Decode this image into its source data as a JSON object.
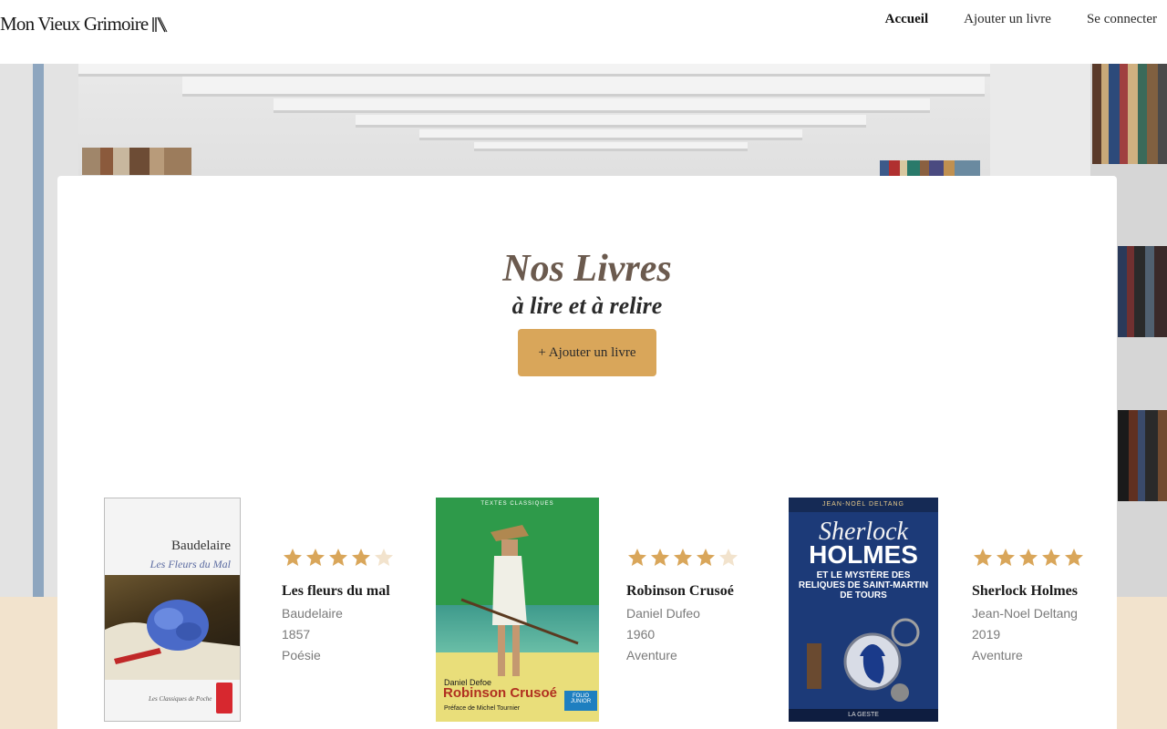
{
  "header": {
    "logo_text": "Mon Vieux Grimoire",
    "nav": [
      {
        "label": "Accueil",
        "active": true
      },
      {
        "label": "Ajouter un livre",
        "active": false
      },
      {
        "label": "Se connecter",
        "active": false
      }
    ]
  },
  "main": {
    "title": "Nos Livres",
    "subtitle": "à lire et à relire",
    "add_button_label": "+ Ajouter un livre"
  },
  "books": [
    {
      "title": "Les fleurs du mal",
      "author": "Baudelaire",
      "year": "1857",
      "genre": "Poésie",
      "rating": 4,
      "cover": {
        "author": "Baudelaire",
        "subtitle": "Les Fleurs du Mal",
        "collection": "Les Classiques de Poche"
      }
    },
    {
      "title": "Robinson Crusoé",
      "author": "Daniel Dufeo",
      "year": "1960",
      "genre": "Aventure",
      "rating": 4,
      "cover": {
        "top": "TEXTES CLASSIQUES",
        "author": "Daniel Defoe",
        "title": "Robinson Crusoé",
        "preface": "Préface de Michel Tournier",
        "badge": "FOLIO JUNIOR"
      }
    },
    {
      "title": "Sherlock Holmes",
      "author": "Jean-Noel Deltang",
      "year": "2019",
      "genre": "Aventure",
      "rating": 5,
      "cover": {
        "author": "JEAN-NOËL DELTANG",
        "title_line1": "Sherlock",
        "title_line2": "HOLMES",
        "subtitle": "ET LE MYSTÈRE DES RELIQUES DE SAINT-MARTIN DE TOURS",
        "publisher": "LA GESTE"
      }
    }
  ],
  "colors": {
    "accent": "#d9a65a",
    "star_filled": "#d9a65a",
    "star_empty": "#f2e3cd",
    "title": "#6b5a4e",
    "beige_band": "#f2e3cd"
  }
}
